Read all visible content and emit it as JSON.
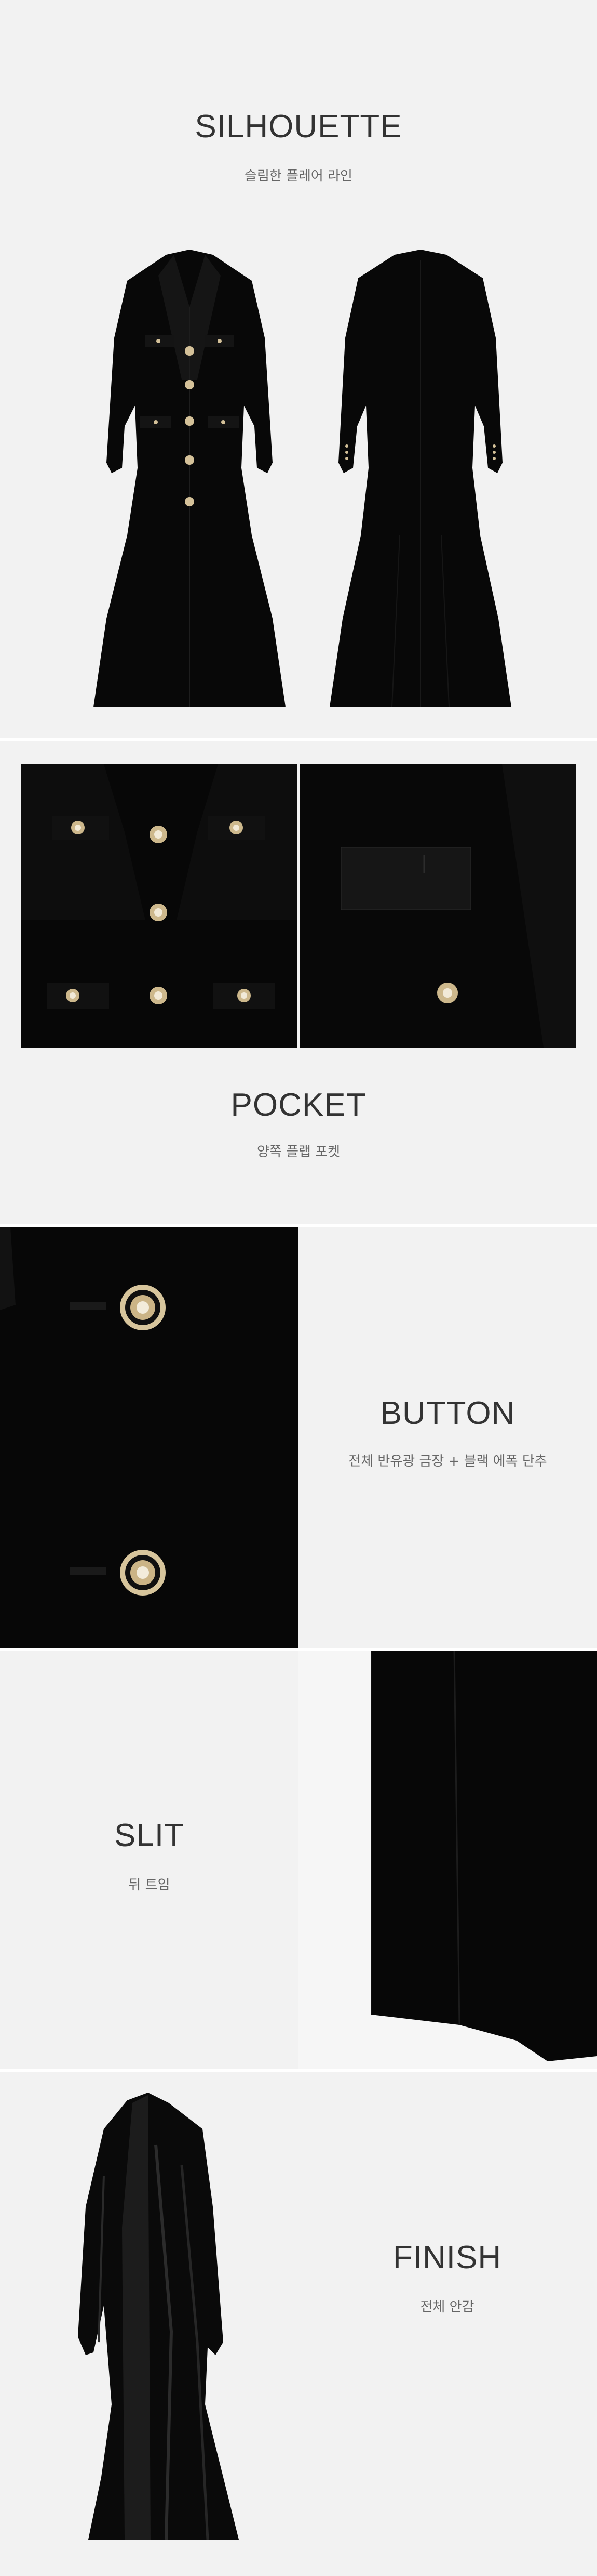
{
  "silhouette": {
    "title": "SILHOUETTE",
    "subtitle": "슬림한 플레어 라인"
  },
  "pocket": {
    "title": "POCKET",
    "subtitle": "양쪽 플랩 포켓"
  },
  "button": {
    "title": "BUTTON",
    "subtitle": "전체 반유광 금장 + 블랙 에폭 단추"
  },
  "slit": {
    "title": "SLIT",
    "subtitle": "뒤 트임"
  },
  "finish": {
    "title": "FINISH",
    "subtitle": "전체 안감"
  },
  "colors": {
    "background": "#f2f2f2",
    "garment": "#070707",
    "gold": "#c8b07a",
    "text": "#333333"
  }
}
